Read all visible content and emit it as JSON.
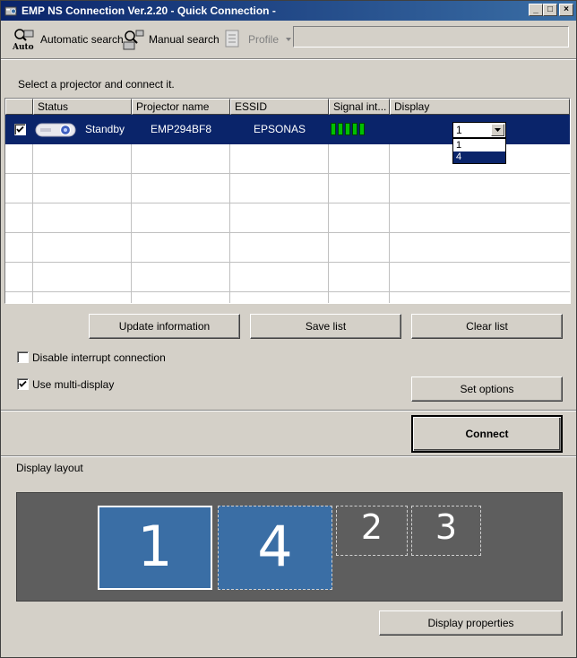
{
  "window": {
    "title": "EMP NS Connection Ver.2.20 - Quick Connection -",
    "minimize": "_",
    "maximize": "□",
    "close": "×"
  },
  "toolbar": {
    "auto_label": "Automatic search",
    "auto_icon_text": "Auto",
    "manual_label": "Manual search",
    "profile_label": "Profile",
    "profile_value": ""
  },
  "instruction": "Select a projector and connect it.",
  "table": {
    "columns": [
      "Status",
      "Projector name",
      "ESSID",
      "Signal int...",
      "Display"
    ],
    "rows": [
      {
        "checked": true,
        "status": "Standby",
        "projector_name": "EMP294BF8",
        "essid": "EPSONAS",
        "signal_bars": 5,
        "display": "1"
      }
    ]
  },
  "display_dropdown": {
    "selected": "1",
    "options": [
      "1",
      "4"
    ],
    "highlighted": "4"
  },
  "buttons": {
    "update": "Update information",
    "save": "Save list",
    "clear": "Clear list",
    "set_options": "Set options",
    "connect": "Connect",
    "display_properties": "Display properties"
  },
  "options": {
    "disable_interrupt": {
      "label": "Disable interrupt connection",
      "checked": false
    },
    "multi_display": {
      "label": "Use multi-display",
      "checked": true
    }
  },
  "display_layout": {
    "title": "Display layout",
    "tiles": [
      "1",
      "4",
      "2",
      "3"
    ]
  },
  "colors": {
    "selection": "#0a246a",
    "signal": "#00c000",
    "tile_active": "#3a6ea5",
    "layout_bg": "#5e5e5e"
  }
}
